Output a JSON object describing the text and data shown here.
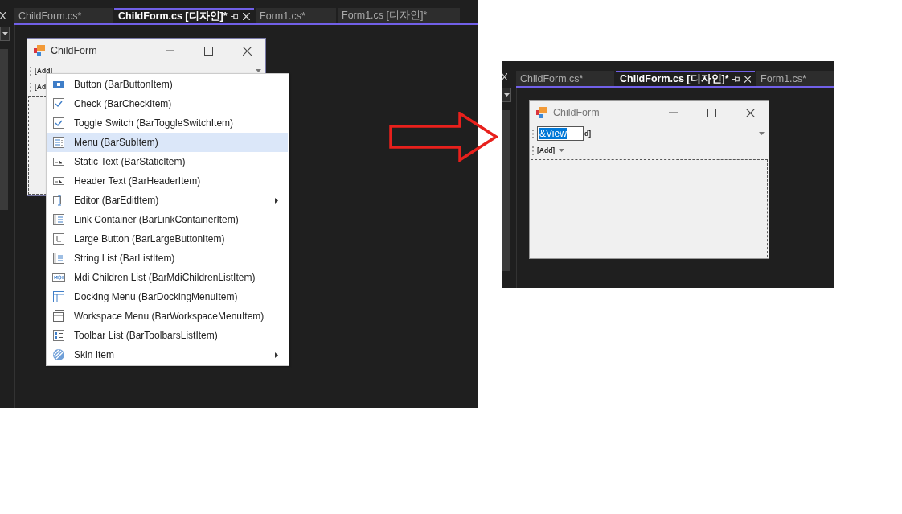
{
  "before": {
    "tabs": [
      {
        "label": "ChildForm.cs*",
        "selected": false
      },
      {
        "label": "ChildForm.cs [디자인]*",
        "selected": true
      },
      {
        "label": "Form1.cs*",
        "selected": false
      },
      {
        "label": "Form1.cs [디자인]*",
        "selected": false
      }
    ],
    "form": {
      "title": "ChildForm",
      "toolbars": [
        {
          "label": "[Add]",
          "has_dropdown": true
        },
        {
          "label": "[Ad",
          "has_dropdown": false
        }
      ]
    },
    "context_menu": {
      "items": [
        {
          "label": "Button (BarButtonItem)",
          "selected": false,
          "has_submenu": false
        },
        {
          "label": "Check (BarCheckItem)",
          "selected": false,
          "has_submenu": false
        },
        {
          "label": "Toggle Switch (BarToggleSwitchItem)",
          "selected": false,
          "has_submenu": false
        },
        {
          "label": "Menu (BarSubItem)",
          "selected": true,
          "has_submenu": false
        },
        {
          "label": "Static Text (BarStaticItem)",
          "selected": false,
          "has_submenu": false
        },
        {
          "label": "Header Text (BarHeaderItem)",
          "selected": false,
          "has_submenu": false
        },
        {
          "label": "Editor (BarEditItem)",
          "selected": false,
          "has_submenu": true
        },
        {
          "label": "Link Container (BarLinkContainerItem)",
          "selected": false,
          "has_submenu": false
        },
        {
          "label": "Large Button (BarLargeButtonItem)",
          "selected": false,
          "has_submenu": false
        },
        {
          "label": "String List (BarListItem)",
          "selected": false,
          "has_submenu": false
        },
        {
          "label": "Mdi Children List (BarMdiChildrenListItem)",
          "selected": false,
          "has_submenu": false
        },
        {
          "label": "Docking Menu (BarDockingMenuItem)",
          "selected": false,
          "has_submenu": false
        },
        {
          "label": "Workspace Menu (BarWorkspaceMenuItem)",
          "selected": false,
          "has_submenu": false
        },
        {
          "label": "Toolbar List (BarToolbarsListItem)",
          "selected": false,
          "has_submenu": false
        },
        {
          "label": "Skin Item",
          "selected": false,
          "has_submenu": true
        }
      ]
    }
  },
  "after": {
    "tabs": [
      {
        "label": "ChildForm.cs*",
        "selected": false
      },
      {
        "label": "ChildForm.cs [디자인]*",
        "selected": true
      },
      {
        "label": "Form1.cs*",
        "selected": false
      }
    ],
    "form": {
      "title": "ChildForm",
      "editor": {
        "value": "&View",
        "behind_text": "d]"
      },
      "toolbars": [
        {
          "label": "[Add]",
          "has_dropdown": true
        }
      ]
    }
  }
}
